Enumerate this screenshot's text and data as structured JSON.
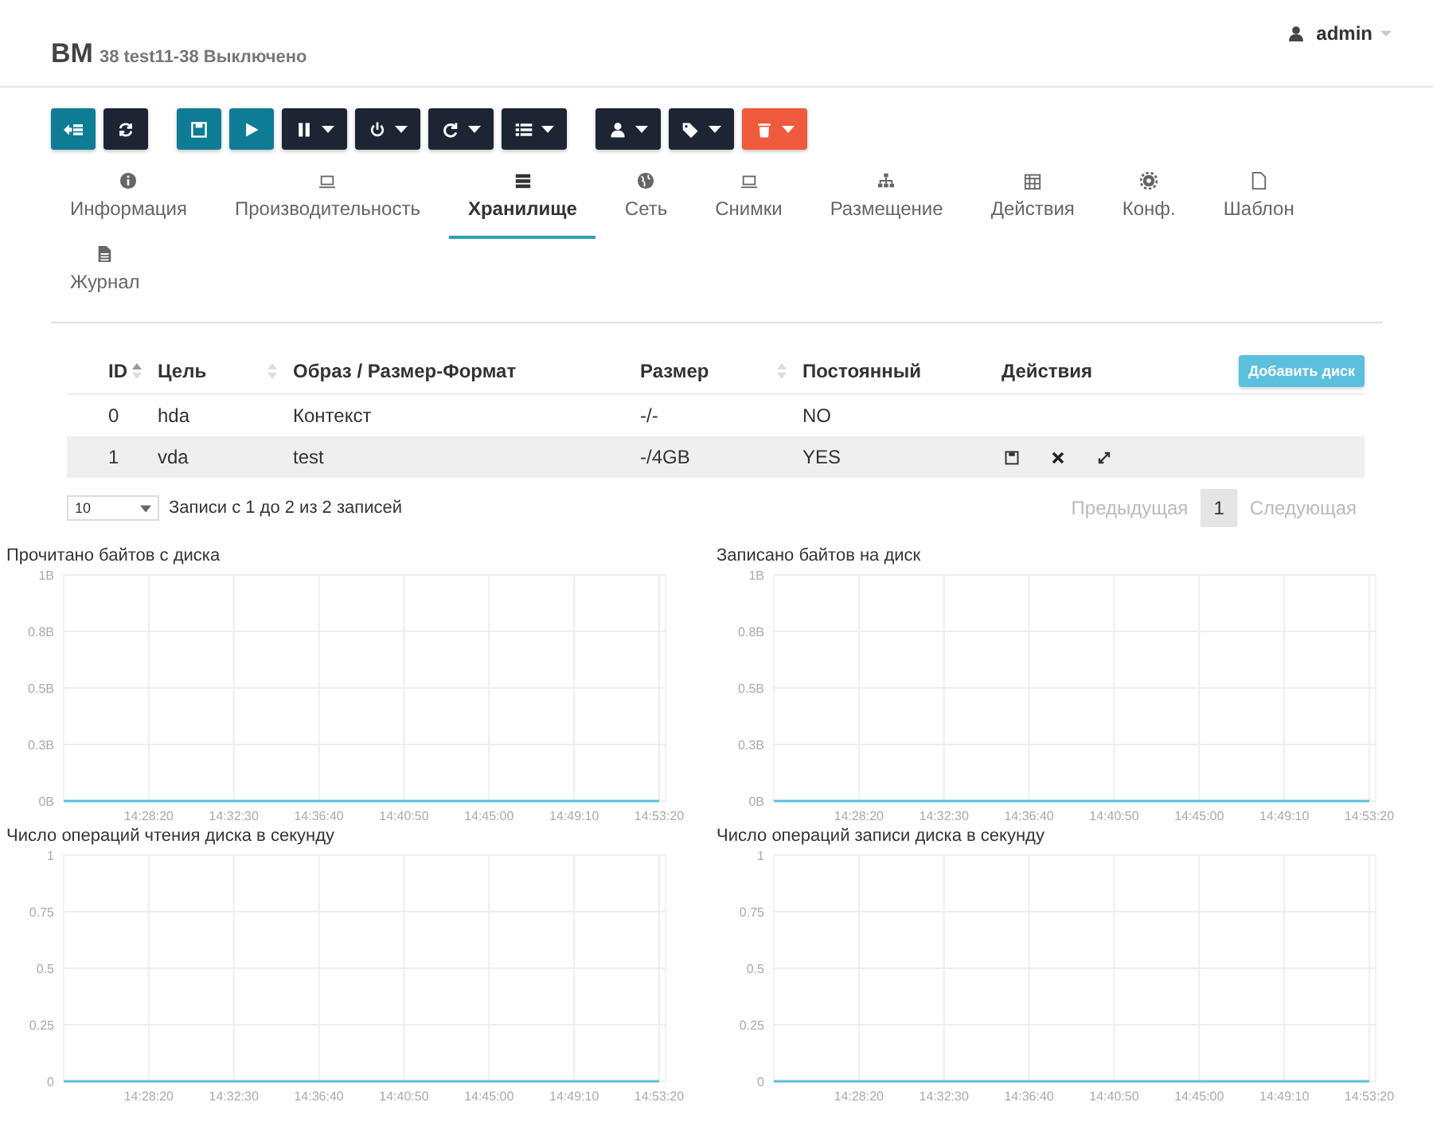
{
  "header": {
    "title": "ВМ",
    "subtitle": "38 test11-38 Выключено",
    "user": "admin"
  },
  "toolbar": [
    [
      {
        "kind": "back",
        "color": "#0e7c95",
        "caret": false
      },
      {
        "kind": "refresh",
        "color": "#1d2433",
        "caret": false
      }
    ],
    [
      {
        "kind": "save",
        "color": "#0e7c95",
        "caret": false
      },
      {
        "kind": "play",
        "color": "#0e7c95",
        "caret": false
      },
      {
        "kind": "pause",
        "color": "#1d2433",
        "caret": true
      },
      {
        "kind": "power",
        "color": "#1d2433",
        "caret": true
      },
      {
        "kind": "redo",
        "color": "#1d2433",
        "caret": true
      },
      {
        "kind": "list",
        "color": "#1d2433",
        "caret": true
      }
    ],
    [
      {
        "kind": "user",
        "color": "#1d2433",
        "caret": true
      },
      {
        "kind": "tags",
        "color": "#1d2433",
        "caret": true
      },
      {
        "kind": "trash",
        "color": "#ef5a3c",
        "caret": true
      }
    ]
  ],
  "tabs": [
    {
      "label": "Информация",
      "kind": "info",
      "selected": false
    },
    {
      "label": "Производительность",
      "kind": "laptop",
      "selected": false
    },
    {
      "label": "Хранилище",
      "kind": "storage",
      "selected": true
    },
    {
      "label": "Сеть",
      "kind": "globe",
      "selected": false
    },
    {
      "label": "Снимки",
      "kind": "laptop",
      "selected": false
    },
    {
      "label": "Размещение",
      "kind": "sitemap",
      "selected": false
    },
    {
      "label": "Действия",
      "kind": "calendar",
      "selected": false
    },
    {
      "label": "Конф.",
      "kind": "gear",
      "selected": false
    },
    {
      "label": "Шаблон",
      "kind": "file",
      "selected": false
    },
    {
      "label": "Журнал",
      "kind": "doc",
      "selected": false
    }
  ],
  "table": {
    "columns": [
      {
        "label": "ID",
        "sortable": true
      },
      {
        "label": "Цель",
        "sortable": true
      },
      {
        "label": "Образ / Размер-Формат",
        "sortable": false
      },
      {
        "label": "Размер",
        "sortable": true
      },
      {
        "label": "Постоянный",
        "sortable": false
      },
      {
        "label": "Действия",
        "sortable": false
      }
    ],
    "add_button": "Добавить диск",
    "rows": [
      {
        "cells": [
          "0",
          "hda",
          "Контекст",
          "-/-",
          "NO"
        ],
        "actions": false
      },
      {
        "cells": [
          "1",
          "vda",
          "test",
          "-/4GB",
          "YES"
        ],
        "actions": true
      }
    ]
  },
  "footer": {
    "page_size": "10",
    "info": "Записи с 1 до 2 из 2 записей",
    "previous": "Предыдущая",
    "page": "1",
    "next": "Следующая"
  },
  "charts": [
    {
      "title": "Прочитано байтов с диска",
      "chart_data": {
        "type": "line",
        "grid": true,
        "categories": [
          null,
          "14:28:20",
          "14:32:30",
          "14:36:40",
          "14:40:50",
          "14:45:00",
          "14:49:10",
          "14:53:20"
        ],
        "series": [
          {
            "color": "#5bc0de",
            "values": [
              0,
              0,
              0,
              0,
              0,
              0,
              0,
              0
            ]
          }
        ],
        "ylim": [
          0,
          1
        ],
        "yticks": [
          {
            "value": 0,
            "label": "0B"
          },
          {
            "value": 0.25,
            "label": "0.3B"
          },
          {
            "value": 0.5,
            "label": "0.5B"
          },
          {
            "value": 0.75,
            "label": "0.8B"
          },
          {
            "value": 1,
            "label": "1B"
          }
        ]
      }
    },
    {
      "title": "Записано байтов на диск",
      "chart_data": {
        "type": "line",
        "grid": true,
        "categories": [
          null,
          "14:28:20",
          "14:32:30",
          "14:36:40",
          "14:40:50",
          "14:45:00",
          "14:49:10",
          "14:53:20"
        ],
        "series": [
          {
            "color": "#5bc0de",
            "values": [
              0,
              0,
              0,
              0,
              0,
              0,
              0,
              0
            ]
          }
        ],
        "ylim": [
          0,
          1
        ],
        "yticks": [
          {
            "value": 0,
            "label": "0B"
          },
          {
            "value": 0.25,
            "label": "0.3B"
          },
          {
            "value": 0.5,
            "label": "0.5B"
          },
          {
            "value": 0.75,
            "label": "0.8B"
          },
          {
            "value": 1,
            "label": "1B"
          }
        ]
      }
    },
    {
      "title": "Число операций чтения диска в секунду",
      "chart_data": {
        "type": "line",
        "grid": true,
        "categories": [
          null,
          "14:28:20",
          "14:32:30",
          "14:36:40",
          "14:40:50",
          "14:45:00",
          "14:49:10",
          "14:53:20"
        ],
        "series": [
          {
            "color": "#5bc0de",
            "values": [
              0,
              0,
              0,
              0,
              0,
              0,
              0,
              0
            ]
          }
        ],
        "ylim": [
          0,
          1
        ],
        "yticks": [
          0,
          0.25,
          0.5,
          0.75,
          1
        ]
      }
    },
    {
      "title": "Число операций записи диска в секунду",
      "chart_data": {
        "type": "line",
        "grid": true,
        "categories": [
          null,
          "14:28:20",
          "14:32:30",
          "14:36:40",
          "14:40:50",
          "14:45:00",
          "14:49:10",
          "14:53:20"
        ],
        "series": [
          {
            "color": "#5bc0de",
            "values": [
              0,
              0,
              0,
              0,
              0,
              0,
              0,
              0
            ]
          }
        ],
        "ylim": [
          0,
          1
        ],
        "yticks": [
          0,
          0.25,
          0.5,
          0.75,
          1
        ]
      }
    }
  ]
}
